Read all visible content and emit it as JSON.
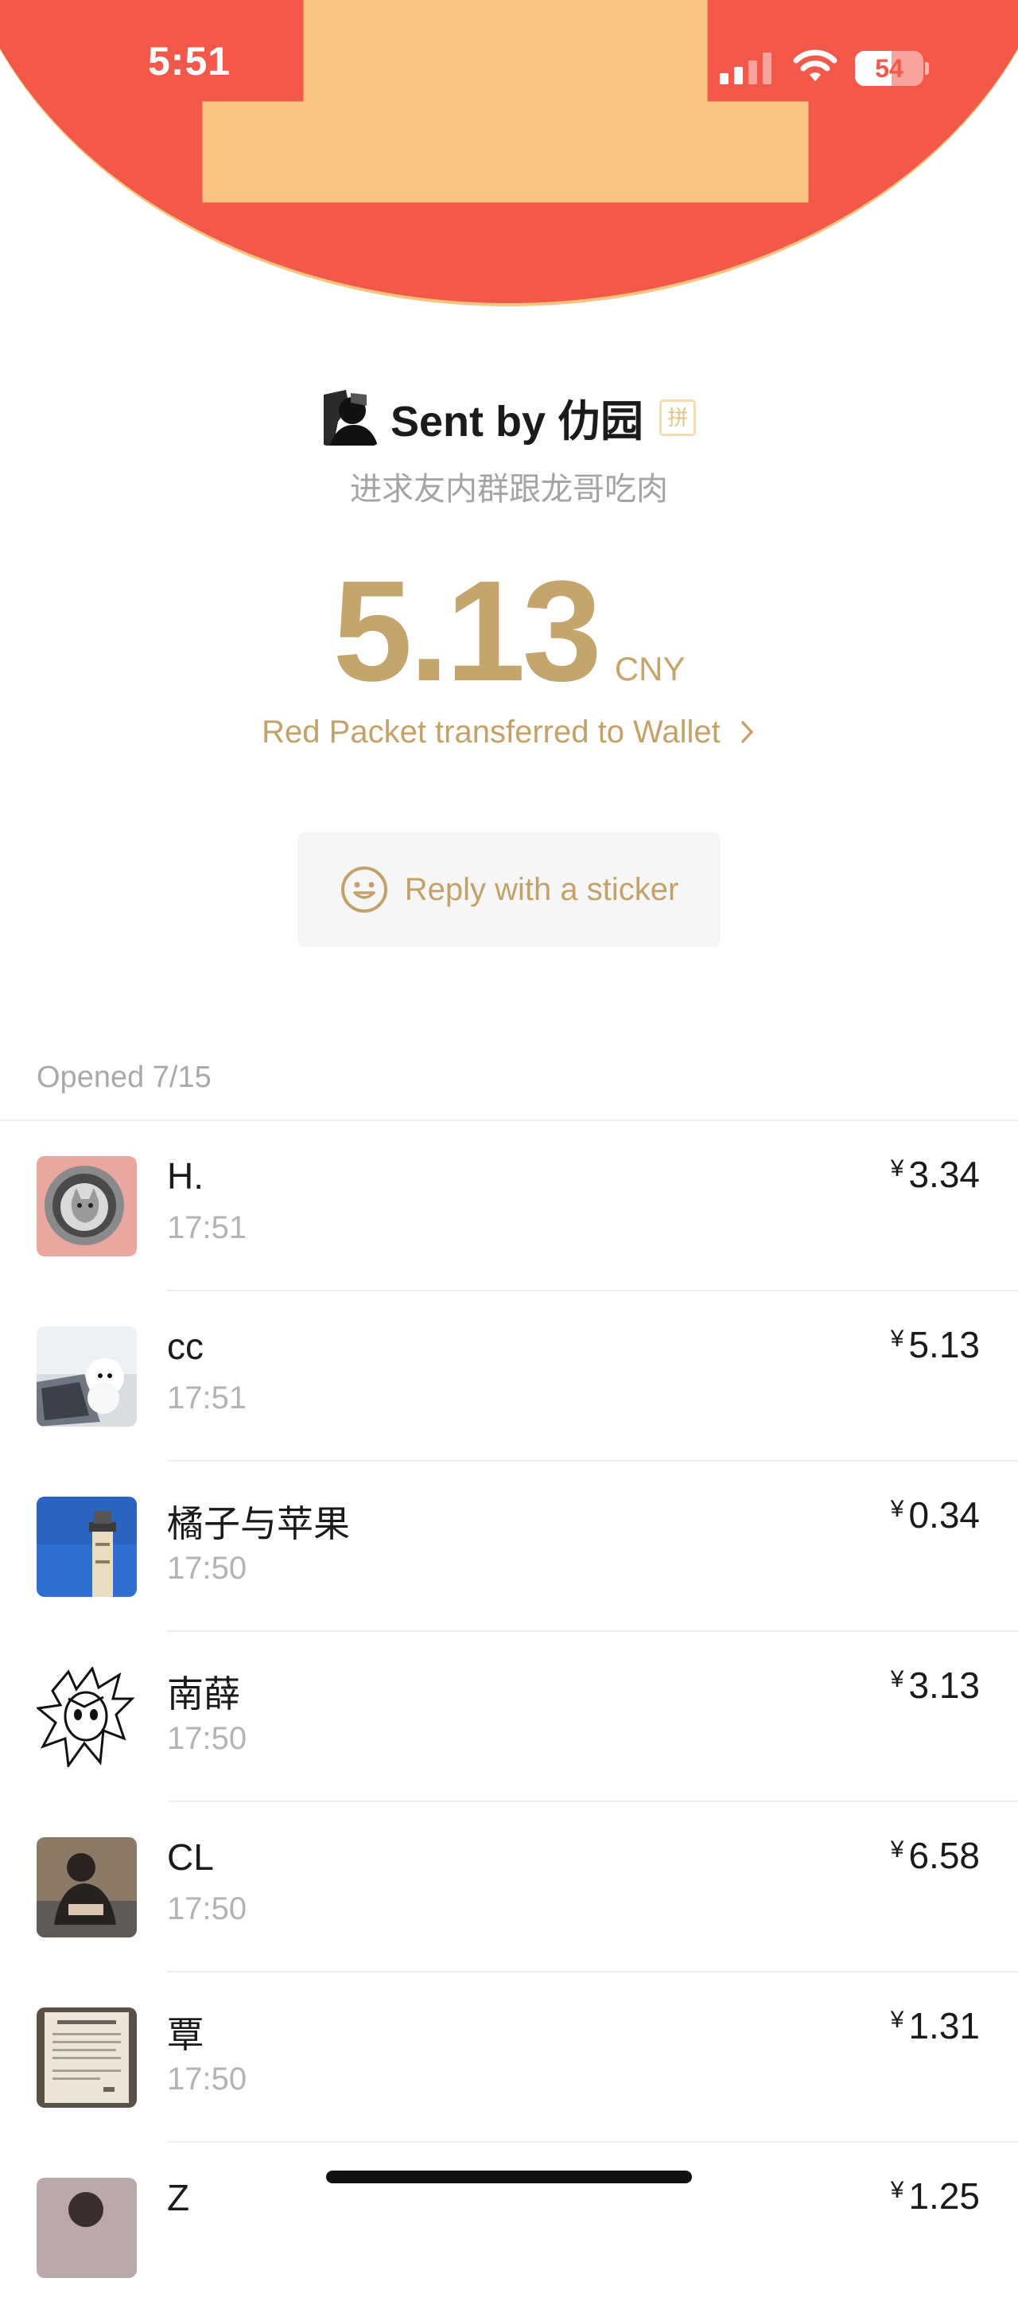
{
  "status_bar": {
    "time": "5:51",
    "battery": "54",
    "battery_level": 0.54
  },
  "colors": {
    "header": "#f2594b",
    "accent_gold": "#c5a56e",
    "border_gold": "#f6c47f"
  },
  "nav": {
    "back_icon": "chevron-left-icon",
    "more_icon": "ellipsis-icon"
  },
  "sender": {
    "name": "Sent by 仂园",
    "badge": "拼"
  },
  "greeting": "进求友内群跟龙哥吃肉",
  "amount": {
    "value": "5.13",
    "currency": "CNY"
  },
  "wallet_link": "Red Packet transferred to Wallet",
  "sticker_button": {
    "label": "Reply with a sticker",
    "icon": "smile-icon"
  },
  "opened_label": "Opened 7/15",
  "recipients": [
    {
      "name": "H.",
      "time": "17:51",
      "currency_symbol": "¥",
      "amount": "3.34"
    },
    {
      "name": "cc",
      "time": "17:51",
      "currency_symbol": "¥",
      "amount": "5.13"
    },
    {
      "name": "橘子与苹果",
      "time": "17:50",
      "currency_symbol": "¥",
      "amount": "0.34"
    },
    {
      "name": "南薛",
      "time": "17:50",
      "currency_symbol": "¥",
      "amount": "3.13"
    },
    {
      "name": "CL",
      "time": "17:50",
      "currency_symbol": "¥",
      "amount": "6.58"
    },
    {
      "name": "覃",
      "time": "17:50",
      "currency_symbol": "¥",
      "amount": "1.31"
    },
    {
      "name": "Z",
      "time": "",
      "currency_symbol": "¥",
      "amount": "1.25"
    }
  ]
}
